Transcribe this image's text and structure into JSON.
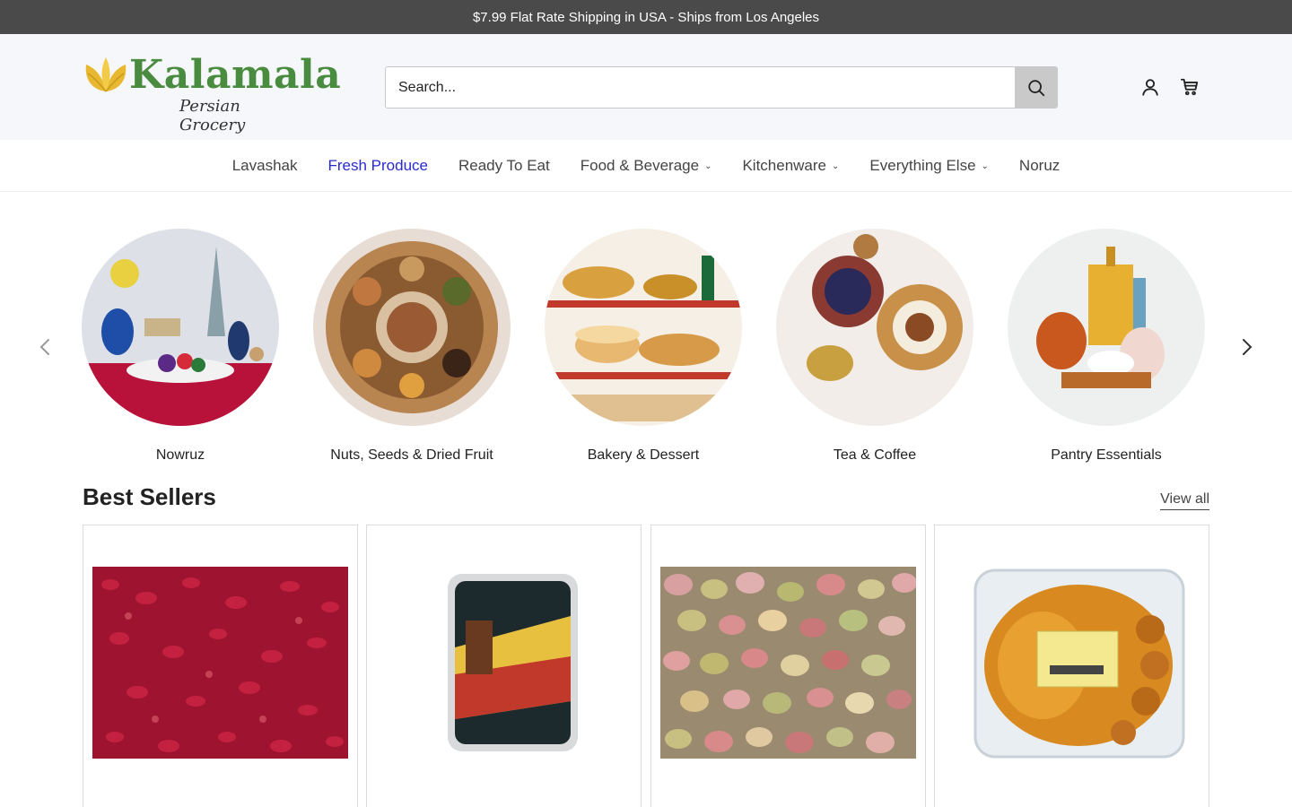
{
  "announcement": {
    "text": "$7.99 Flat Rate Shipping in USA - Ships from Los Angeles"
  },
  "header": {
    "logo": {
      "name": "Kalamala",
      "tagline": "Persian Grocery"
    },
    "search": {
      "placeholder": "Search..."
    },
    "icons": [
      "search-icon",
      "account-icon",
      "cart-icon"
    ]
  },
  "nav": {
    "items": [
      {
        "label": "Lavashak",
        "dropdown": false,
        "active": false
      },
      {
        "label": "Fresh Produce",
        "dropdown": false,
        "active": true
      },
      {
        "label": "Ready To Eat",
        "dropdown": false,
        "active": false
      },
      {
        "label": "Food & Beverage",
        "dropdown": true,
        "active": false
      },
      {
        "label": "Kitchenware",
        "dropdown": true,
        "active": false
      },
      {
        "label": "Everything Else",
        "dropdown": true,
        "active": false
      },
      {
        "label": "Noruz",
        "dropdown": false,
        "active": false
      }
    ],
    "active_color": "#2a2ad0"
  },
  "categories": {
    "items": [
      {
        "label": "Nowruz"
      },
      {
        "label": "Nuts, Seeds & Dried Fruit"
      },
      {
        "label": "Bakery & Dessert"
      },
      {
        "label": "Tea & Coffee"
      },
      {
        "label": "Pantry Essentials"
      }
    ],
    "icons": [
      "chevron-left-icon",
      "chevron-right-icon"
    ]
  },
  "best_sellers": {
    "title": "Best Sellers",
    "view_all": "View all",
    "products": [
      {
        "image": "dried barberries"
      },
      {
        "image": "Roll Lavashak package"
      },
      {
        "image": "fresh pistachios"
      },
      {
        "image": "zoolbia bamieh pastry box"
      }
    ]
  },
  "colors": {
    "announcement_bg": "#4a4a4a",
    "header_bg": "#f6f7fb",
    "brand_green": "#4a8c3f",
    "brand_yellow": "#e8b830"
  }
}
